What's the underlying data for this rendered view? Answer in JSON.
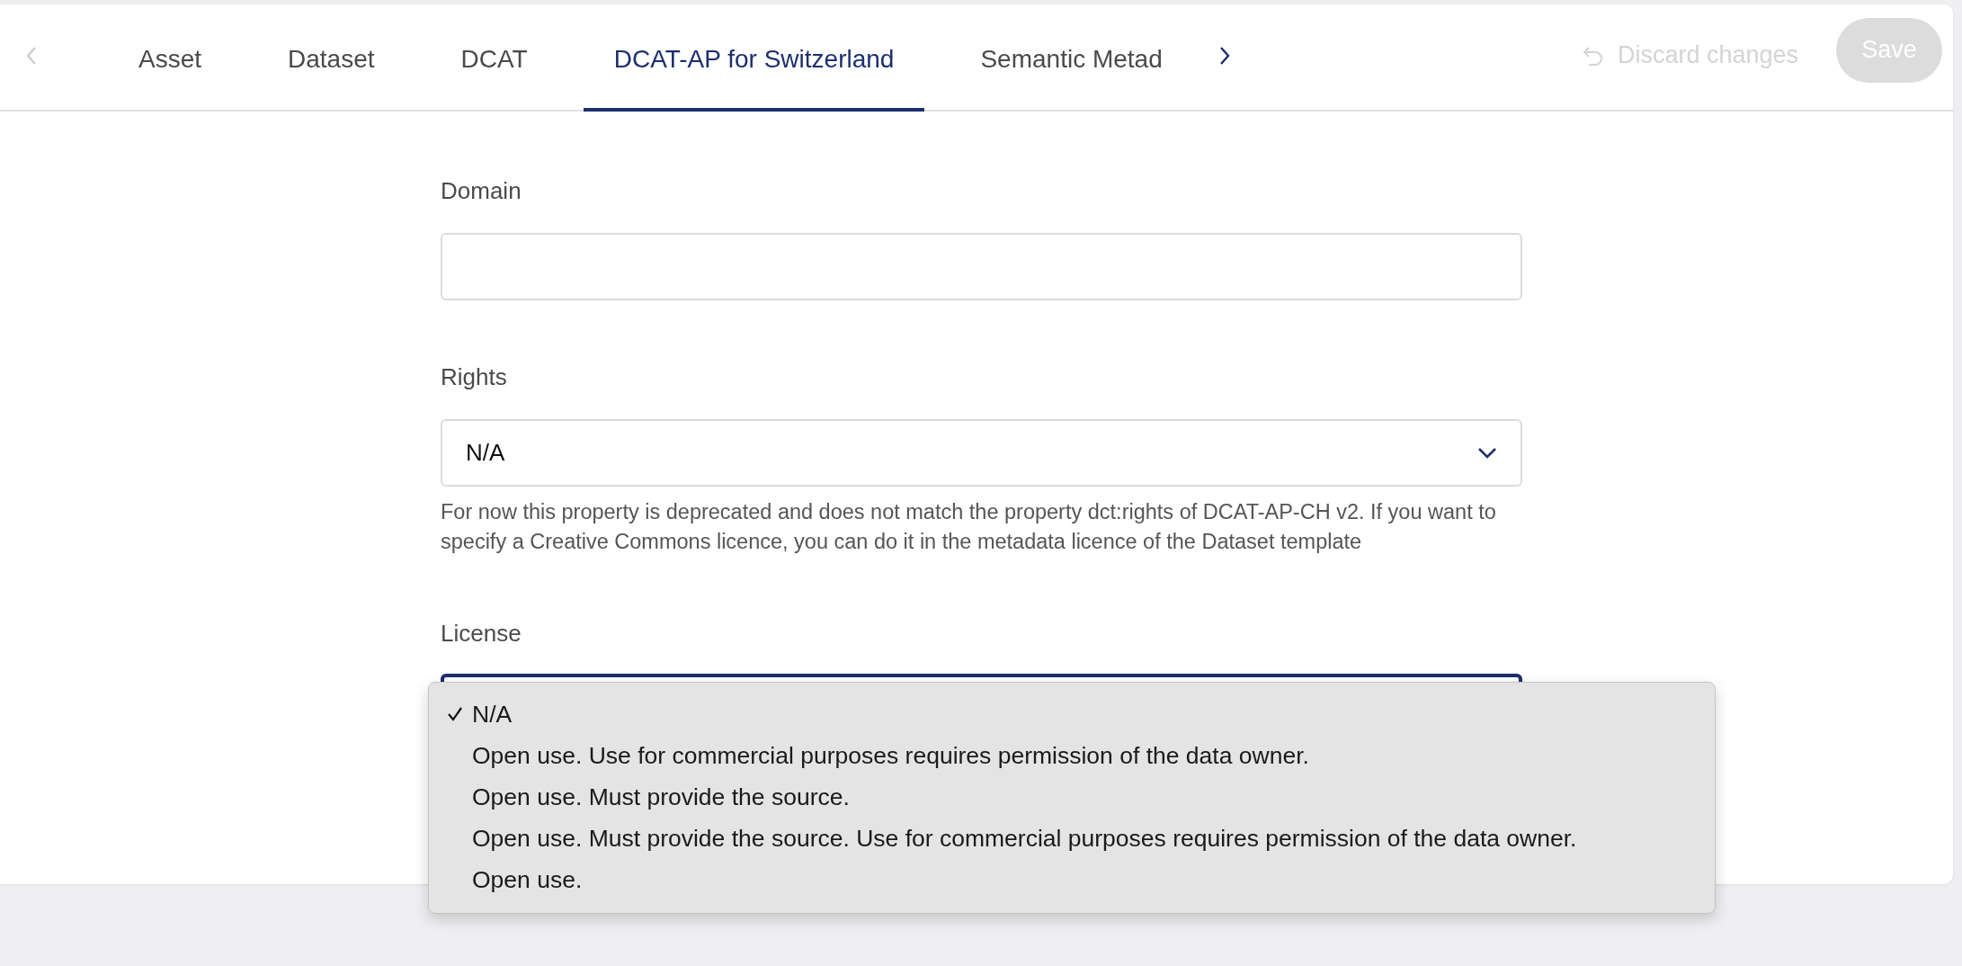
{
  "tab_bar": {
    "prev": {
      "disabled": true
    },
    "next": {
      "disabled": false
    },
    "tabs": [
      {
        "label": "Asset",
        "selected": false
      },
      {
        "label": "Dataset",
        "selected": false
      },
      {
        "label": "DCAT",
        "selected": false
      },
      {
        "label": "DCAT-AP for Switzerland",
        "selected": true
      },
      {
        "label": "Semantic Metad",
        "selected": false
      }
    ],
    "discard": {
      "label": "Discard changes",
      "disabled": true
    },
    "save": {
      "label": "Save",
      "disabled": true
    }
  },
  "form": {
    "domain": {
      "label": "Domain"
    },
    "rights": {
      "label": "Rights",
      "value": "N/A",
      "help": "For now this property is deprecated and does not match the property dct:rights of DCAT-AP-CH v2. If you want to specify a Creative Commons licence, you can do it in the metadata licence of the Dataset template"
    },
    "license": {
      "label": "License",
      "options": [
        {
          "label": "N/A",
          "selected": true
        },
        {
          "label": "Open use. Use for commercial purposes requires permission of the data owner.",
          "selected": false
        },
        {
          "label": "Open use. Must provide the source.",
          "selected": false
        },
        {
          "label": "Open use. Must provide the source. Use for commercial purposes requires permission of the data owner.",
          "selected": false
        },
        {
          "label": "Open use.",
          "selected": false
        }
      ]
    }
  }
}
